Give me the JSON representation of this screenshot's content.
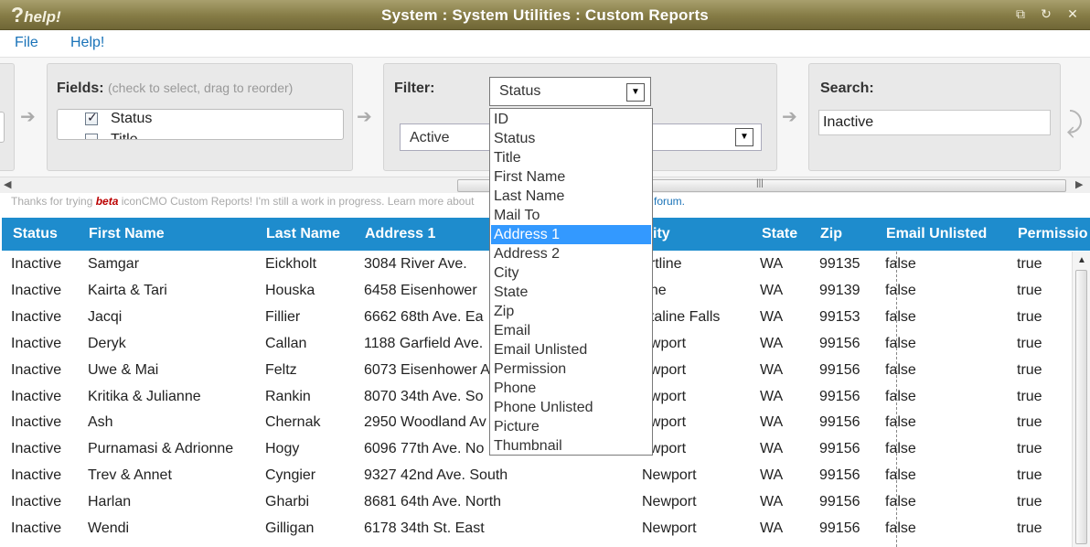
{
  "window": {
    "logo": "help!",
    "logo_mark": "?",
    "title": "System : System Utilities : Custom Reports",
    "buttons": [
      "restore-icon",
      "refresh-icon",
      "close-icon"
    ]
  },
  "menu": {
    "file": "File",
    "help": "Help!"
  },
  "fields_panel": {
    "title": "Fields:",
    "hint": "(check to select, drag to reorder)",
    "items": [
      {
        "label": "Status",
        "checked": true
      },
      {
        "label": "Title",
        "checked": false
      }
    ]
  },
  "filter_panel": {
    "title": "Filter:",
    "field_value": "Status",
    "value_value": "Active"
  },
  "search_panel": {
    "title": "Search:",
    "value": "Inactive"
  },
  "notice": {
    "prefix": "Thanks for trying ",
    "beta": "beta",
    "suffix": " iconCMO Custom Reports! I'm still a work in progress. Learn more about",
    "link": "forum."
  },
  "dropdown": {
    "selected": "Address 1",
    "options": [
      "ID",
      "Status",
      "Title",
      "First Name",
      "Last Name",
      "Mail To",
      "Address 1",
      "Address 2",
      "City",
      "State",
      "Zip",
      "Email",
      "Email Unlisted",
      "Permission",
      "Phone",
      "Phone Unlisted",
      "Picture",
      "Thumbnail"
    ]
  },
  "table": {
    "headers": [
      "Status",
      "First Name",
      "Last Name",
      "Address 1",
      "City",
      "State",
      "Zip",
      "Email Unlisted",
      "Permission"
    ],
    "header_visible": [
      "Status",
      "First Name",
      "Last Name",
      "Address 1",
      "ity",
      "State",
      "Zip",
      "Email Unlisted",
      "Permissio"
    ],
    "rows": [
      [
        "Inactive",
        "Samgar",
        "Eickholt",
        "3084 River Ave.",
        "artline",
        "WA",
        "99135",
        "false",
        "true"
      ],
      [
        "Inactive",
        "Kairta & Tari",
        "Houska",
        "6458 Eisenhower",
        "one",
        "WA",
        "99139",
        "false",
        "true"
      ],
      [
        "Inactive",
        "Jacqi",
        "Fillier",
        "6662 68th Ave. Ea",
        "etaline Falls",
        "WA",
        "99153",
        "false",
        "true"
      ],
      [
        "Inactive",
        "Deryk",
        "Callan",
        "1188 Garfield Ave.",
        "ewport",
        "WA",
        "99156",
        "false",
        "true"
      ],
      [
        "Inactive",
        "Uwe & Mai",
        "Feltz",
        "6073 Eisenhower A",
        "ewport",
        "WA",
        "99156",
        "false",
        "true"
      ],
      [
        "Inactive",
        "Kritika & Julianne",
        "Rankin",
        "8070 34th Ave. So",
        "ewport",
        "WA",
        "99156",
        "false",
        "true"
      ],
      [
        "Inactive",
        "Ash",
        "Chernak",
        "2950 Woodland Av",
        "ewport",
        "WA",
        "99156",
        "false",
        "true"
      ],
      [
        "Inactive",
        "Purnamasi & Adrionne",
        "Hogy",
        "6096 77th Ave. No",
        "ewport",
        "WA",
        "99156",
        "false",
        "true"
      ],
      [
        "Inactive",
        "Trev & Annet",
        "Cyngier",
        "9327 42nd Ave. South",
        "Newport",
        "WA",
        "99156",
        "false",
        "true"
      ],
      [
        "Inactive",
        "Harlan",
        "Gharbi",
        "8681 64th Ave. North",
        "Newport",
        "WA",
        "99156",
        "false",
        "true"
      ],
      [
        "Inactive",
        "Wendi",
        "Gilligan",
        "6178 34th St. East",
        "Newport",
        "WA",
        "99156",
        "false",
        "true"
      ]
    ]
  },
  "colors": {
    "header_bar": "#1e8ccd",
    "title_bar": "#857b45",
    "selected_option": "#3399ff",
    "link": "#1a73b8"
  }
}
